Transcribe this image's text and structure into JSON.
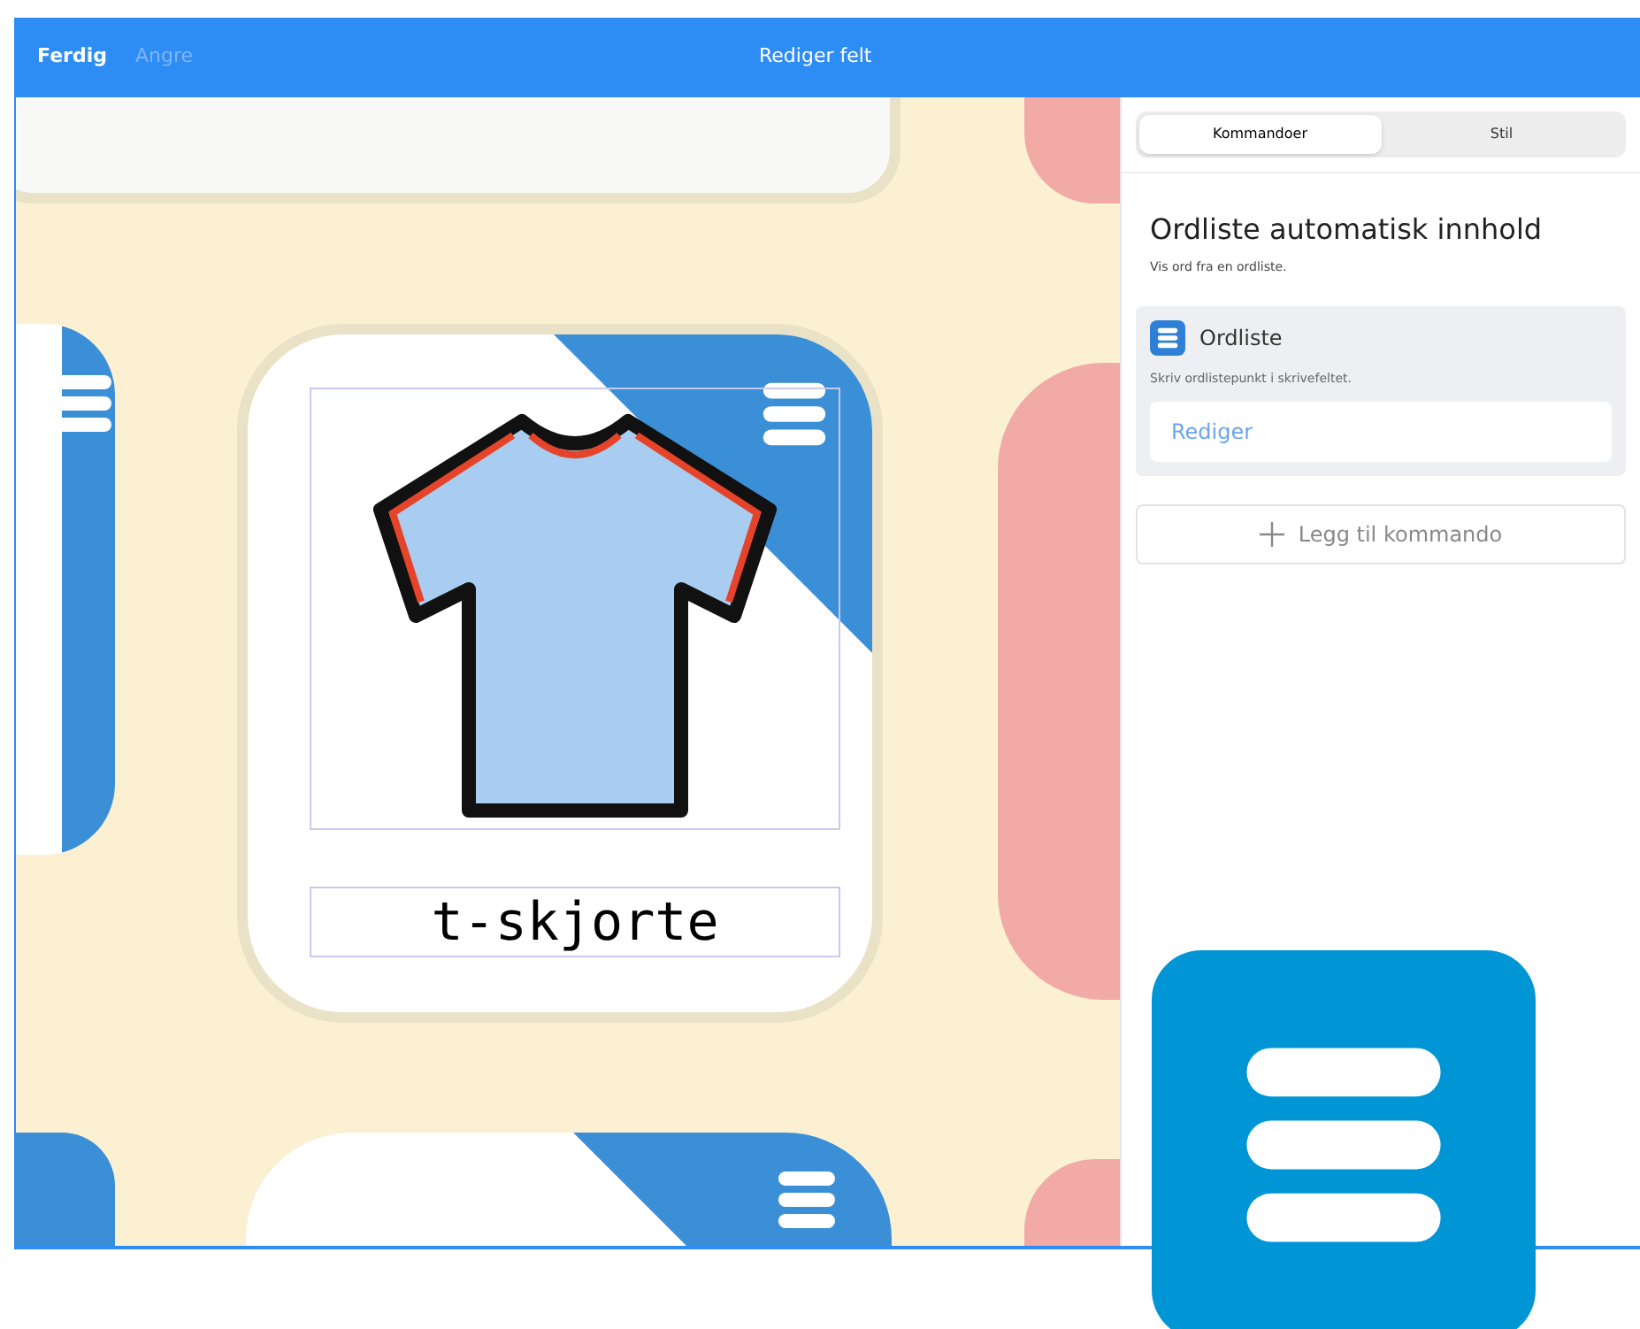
{
  "top_bar": {
    "done": "Ferdig",
    "undo": {
      "label": "Angre",
      "disabled": true
    },
    "title": "Rediger felt"
  },
  "canvas": {
    "cell_label": "t-skjorte"
  },
  "tabs": [
    {
      "label": "Kommandoer",
      "selected": true
    },
    {
      "label": "Stil",
      "selected": false
    }
  ],
  "panel": {
    "title": "Ordliste automatisk innhold",
    "subtitle": "Vis ord fra en ordliste.",
    "command": {
      "title": "Ordliste",
      "hint": "Skriv ordlistepunkt i skrivefeltet.",
      "button": "Rediger"
    },
    "add_button": "Legg til kommando"
  }
}
